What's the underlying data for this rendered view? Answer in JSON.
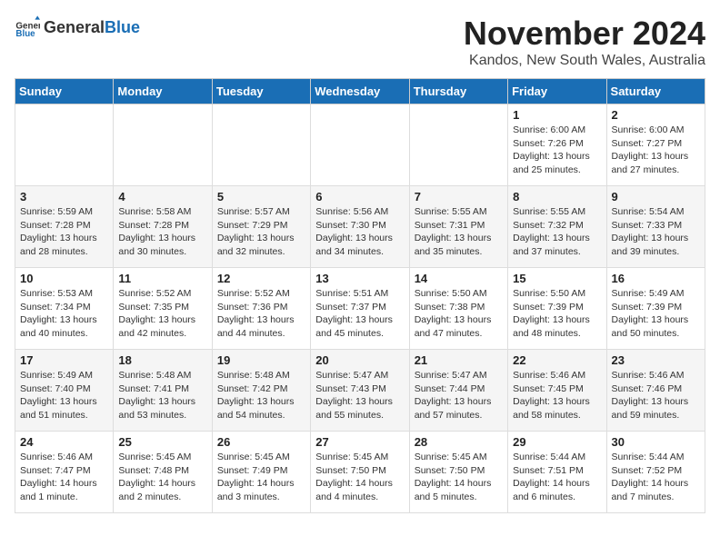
{
  "logo": {
    "text_general": "General",
    "text_blue": "Blue"
  },
  "title": "November 2024",
  "location": "Kandos, New South Wales, Australia",
  "weekdays": [
    "Sunday",
    "Monday",
    "Tuesday",
    "Wednesday",
    "Thursday",
    "Friday",
    "Saturday"
  ],
  "weeks": [
    [
      {
        "day": "",
        "info": ""
      },
      {
        "day": "",
        "info": ""
      },
      {
        "day": "",
        "info": ""
      },
      {
        "day": "",
        "info": ""
      },
      {
        "day": "",
        "info": ""
      },
      {
        "day": "1",
        "info": "Sunrise: 6:00 AM\nSunset: 7:26 PM\nDaylight: 13 hours and 25 minutes."
      },
      {
        "day": "2",
        "info": "Sunrise: 6:00 AM\nSunset: 7:27 PM\nDaylight: 13 hours and 27 minutes."
      }
    ],
    [
      {
        "day": "3",
        "info": "Sunrise: 5:59 AM\nSunset: 7:28 PM\nDaylight: 13 hours and 28 minutes."
      },
      {
        "day": "4",
        "info": "Sunrise: 5:58 AM\nSunset: 7:28 PM\nDaylight: 13 hours and 30 minutes."
      },
      {
        "day": "5",
        "info": "Sunrise: 5:57 AM\nSunset: 7:29 PM\nDaylight: 13 hours and 32 minutes."
      },
      {
        "day": "6",
        "info": "Sunrise: 5:56 AM\nSunset: 7:30 PM\nDaylight: 13 hours and 34 minutes."
      },
      {
        "day": "7",
        "info": "Sunrise: 5:55 AM\nSunset: 7:31 PM\nDaylight: 13 hours and 35 minutes."
      },
      {
        "day": "8",
        "info": "Sunrise: 5:55 AM\nSunset: 7:32 PM\nDaylight: 13 hours and 37 minutes."
      },
      {
        "day": "9",
        "info": "Sunrise: 5:54 AM\nSunset: 7:33 PM\nDaylight: 13 hours and 39 minutes."
      }
    ],
    [
      {
        "day": "10",
        "info": "Sunrise: 5:53 AM\nSunset: 7:34 PM\nDaylight: 13 hours and 40 minutes."
      },
      {
        "day": "11",
        "info": "Sunrise: 5:52 AM\nSunset: 7:35 PM\nDaylight: 13 hours and 42 minutes."
      },
      {
        "day": "12",
        "info": "Sunrise: 5:52 AM\nSunset: 7:36 PM\nDaylight: 13 hours and 44 minutes."
      },
      {
        "day": "13",
        "info": "Sunrise: 5:51 AM\nSunset: 7:37 PM\nDaylight: 13 hours and 45 minutes."
      },
      {
        "day": "14",
        "info": "Sunrise: 5:50 AM\nSunset: 7:38 PM\nDaylight: 13 hours and 47 minutes."
      },
      {
        "day": "15",
        "info": "Sunrise: 5:50 AM\nSunset: 7:39 PM\nDaylight: 13 hours and 48 minutes."
      },
      {
        "day": "16",
        "info": "Sunrise: 5:49 AM\nSunset: 7:39 PM\nDaylight: 13 hours and 50 minutes."
      }
    ],
    [
      {
        "day": "17",
        "info": "Sunrise: 5:49 AM\nSunset: 7:40 PM\nDaylight: 13 hours and 51 minutes."
      },
      {
        "day": "18",
        "info": "Sunrise: 5:48 AM\nSunset: 7:41 PM\nDaylight: 13 hours and 53 minutes."
      },
      {
        "day": "19",
        "info": "Sunrise: 5:48 AM\nSunset: 7:42 PM\nDaylight: 13 hours and 54 minutes."
      },
      {
        "day": "20",
        "info": "Sunrise: 5:47 AM\nSunset: 7:43 PM\nDaylight: 13 hours and 55 minutes."
      },
      {
        "day": "21",
        "info": "Sunrise: 5:47 AM\nSunset: 7:44 PM\nDaylight: 13 hours and 57 minutes."
      },
      {
        "day": "22",
        "info": "Sunrise: 5:46 AM\nSunset: 7:45 PM\nDaylight: 13 hours and 58 minutes."
      },
      {
        "day": "23",
        "info": "Sunrise: 5:46 AM\nSunset: 7:46 PM\nDaylight: 13 hours and 59 minutes."
      }
    ],
    [
      {
        "day": "24",
        "info": "Sunrise: 5:46 AM\nSunset: 7:47 PM\nDaylight: 14 hours and 1 minute."
      },
      {
        "day": "25",
        "info": "Sunrise: 5:45 AM\nSunset: 7:48 PM\nDaylight: 14 hours and 2 minutes."
      },
      {
        "day": "26",
        "info": "Sunrise: 5:45 AM\nSunset: 7:49 PM\nDaylight: 14 hours and 3 minutes."
      },
      {
        "day": "27",
        "info": "Sunrise: 5:45 AM\nSunset: 7:50 PM\nDaylight: 14 hours and 4 minutes."
      },
      {
        "day": "28",
        "info": "Sunrise: 5:45 AM\nSunset: 7:50 PM\nDaylight: 14 hours and 5 minutes."
      },
      {
        "day": "29",
        "info": "Sunrise: 5:44 AM\nSunset: 7:51 PM\nDaylight: 14 hours and 6 minutes."
      },
      {
        "day": "30",
        "info": "Sunrise: 5:44 AM\nSunset: 7:52 PM\nDaylight: 14 hours and 7 minutes."
      }
    ]
  ]
}
